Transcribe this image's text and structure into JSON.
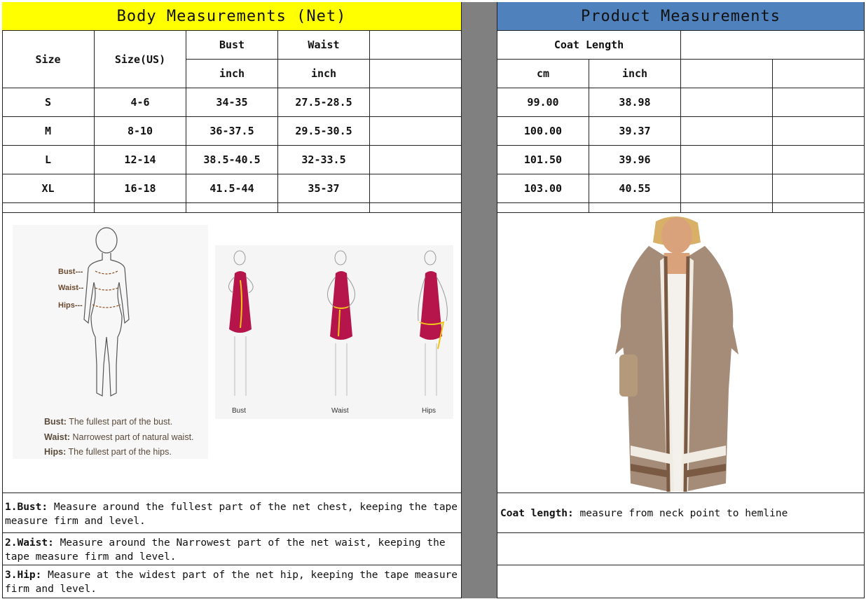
{
  "left_header": "Body Measurements (Net)",
  "right_header": "Product Measurements",
  "left_table": {
    "col_size": "Size",
    "col_size_us": "Size(US)",
    "col_bust": "Bust",
    "col_waist": "Waist",
    "unit_bust": "inch",
    "unit_waist": "inch",
    "rows": [
      {
        "size": "S",
        "us": "4-6",
        "bust": "34-35",
        "waist": "27.5-28.5"
      },
      {
        "size": "M",
        "us": "8-10",
        "bust": "36-37.5",
        "waist": "29.5-30.5"
      },
      {
        "size": "L",
        "us": "12-14",
        "bust": "38.5-40.5",
        "waist": "32-33.5"
      },
      {
        "size": "XL",
        "us": "16-18",
        "bust": "41.5-44",
        "waist": "35-37"
      }
    ]
  },
  "right_table": {
    "col_coat_length": "Coat Length",
    "unit_cm": "cm",
    "unit_inch": "inch",
    "rows": [
      {
        "cm": "99.00",
        "inch": "38.98"
      },
      {
        "cm": "100.00",
        "inch": "39.37"
      },
      {
        "cm": "101.50",
        "inch": "39.96"
      },
      {
        "cm": "103.00",
        "inch": "40.55"
      }
    ]
  },
  "figure1": {
    "marks": [
      "Bust---",
      "Waist--",
      "Hips---"
    ],
    "defs": [
      {
        "term": "Bust:",
        "text": "The fullest part of the bust."
      },
      {
        "term": "Waist:",
        "text": "Narrowest part of natural waist."
      },
      {
        "term": "Hips:",
        "text": "The fullest part of the hips."
      }
    ]
  },
  "figure2": {
    "captions": [
      "Bust",
      "Waist",
      "Hips"
    ]
  },
  "notes": [
    {
      "term": "1.Bust:",
      "text": " Measure around the fullest part of the net chest, keeping the tape  measure firm and level."
    },
    {
      "term": "2.Waist:",
      "text": " Measure around the Narrowest part of the net waist, keeping the tape  measure firm and level."
    },
    {
      "term": "3.Hip:",
      "text": " Measure at the widest part of the net hip, keeping the tape measure firm and level."
    }
  ],
  "coat_note": {
    "term": "Coat length:",
    "text": " measure from neck point to hemline"
  },
  "colors": {
    "yellow": "#ffff00",
    "blue": "#4f81bd",
    "gray": "#808080",
    "dress": "#b5154b"
  }
}
